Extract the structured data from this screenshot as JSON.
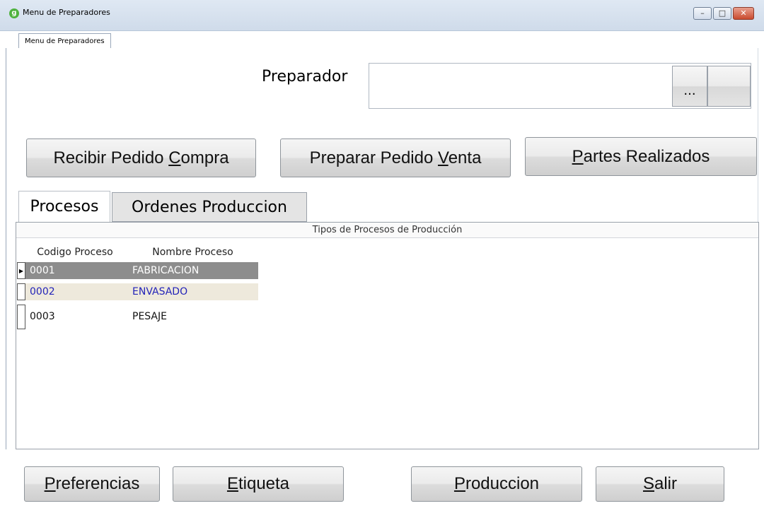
{
  "window": {
    "title": "Menu de Preparadores",
    "icon": "g",
    "minimize": "–",
    "maximize": "□",
    "close": "✕"
  },
  "top_tab": "Menu de Preparadores",
  "preparador": {
    "label": "Preparador",
    "value": "",
    "browse_button": "...",
    "clear_button": ""
  },
  "actions": {
    "recibir": {
      "pre": "Recibir Pedido ",
      "key": "C",
      "post": "ompra"
    },
    "preparar": {
      "pre": "Preparar Pedido ",
      "key": "V",
      "post": "enta"
    },
    "partes": {
      "pre": "",
      "key": "P",
      "post": "artes Realizados"
    }
  },
  "tabs": [
    {
      "label": "Procesos",
      "active": true
    },
    {
      "label": "Ordenes Produccion",
      "active": false
    }
  ],
  "grid": {
    "caption": "Tipos de Procesos de Producción",
    "columns": [
      "Codigo Proceso",
      "Nombre Proceso"
    ],
    "rows": [
      {
        "codigo": "0001",
        "nombre": "FABRICACION",
        "selected": true
      },
      {
        "codigo": "0002",
        "nombre": "ENVASADO",
        "selected": false
      },
      {
        "codigo": "0003",
        "nombre": "PESAJE",
        "selected": false
      }
    ],
    "current_row_marker": "▶"
  },
  "bottom": {
    "preferencias": {
      "key": "P",
      "post": "referencias"
    },
    "etiqueta": {
      "key": "E",
      "post": "tiqueta"
    },
    "produccion": {
      "key": "P",
      "post": "roduccion"
    },
    "salir": {
      "key": "S",
      "post": "alir"
    }
  },
  "colors": {
    "selected_row": "#8d8d8d",
    "alt_row": "#eee9dc",
    "alt_row_text": "#2323b8",
    "app_icon": "#4fb23e",
    "close_button": "#c94a2e"
  }
}
